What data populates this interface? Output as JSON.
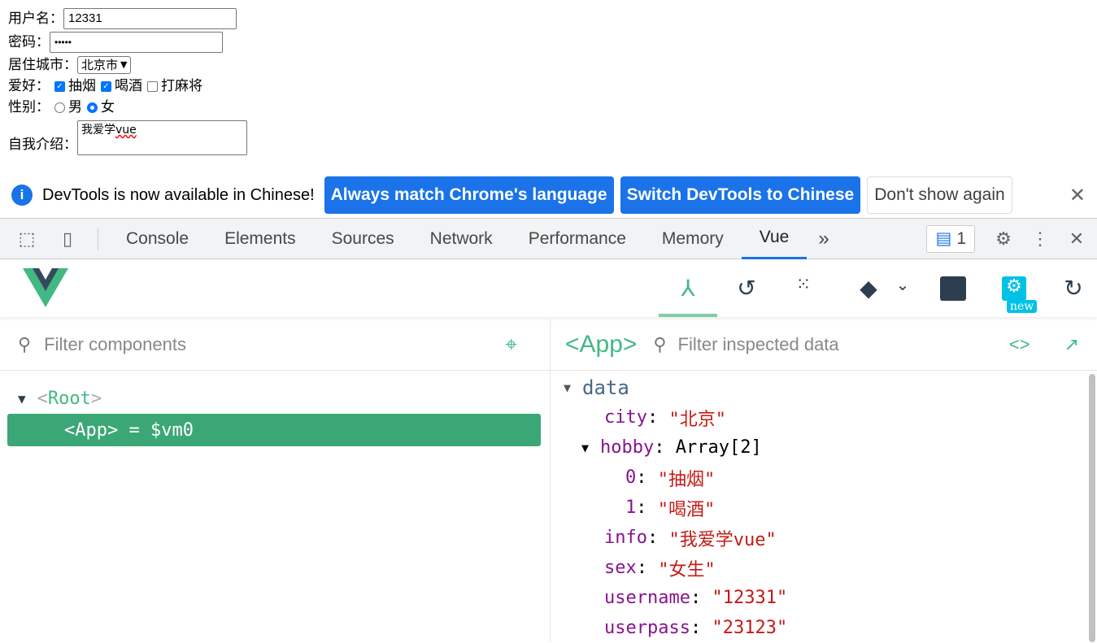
{
  "form": {
    "username_label": "用户名：",
    "username": "12331",
    "password_label": "密码：",
    "password_mask": "•••••",
    "city_label": "居住城市：",
    "city_selected": "北京市",
    "hobby_label": "爱好：",
    "hobbies": [
      {
        "label": "抽烟",
        "checked": true
      },
      {
        "label": "喝酒",
        "checked": true
      },
      {
        "label": "打麻将",
        "checked": false
      }
    ],
    "sex_label": "性别：",
    "sexes": [
      {
        "label": "男",
        "checked": false
      },
      {
        "label": "女",
        "checked": true
      }
    ],
    "intro_label": "自我介绍：",
    "intro_cn": "我爱学",
    "intro_en": "vue"
  },
  "infobar": {
    "icon": "info-icon",
    "message": "DevTools is now available in Chinese!",
    "btn1": "Always match Chrome's language",
    "btn2": "Switch DevTools to Chinese",
    "btn3": "Don't show again",
    "close": "✕"
  },
  "devtools": {
    "tabs": [
      "Console",
      "Elements",
      "Sources",
      "Network",
      "Performance",
      "Memory",
      "Vue"
    ],
    "active_tab": "Vue",
    "more": "»",
    "issues_count": "1",
    "accent": "#1a73e8"
  },
  "vue": {
    "new_badge": "new",
    "accent": "#42b983",
    "filter_components": "Filter components",
    "filter_inspected": "Filter inspected data",
    "selected": "<App>",
    "tree": {
      "root": "Root",
      "app": "App",
      "vm": "= $vm0"
    },
    "data": {
      "section": "data",
      "rows": [
        {
          "key": "city",
          "value": "\"北京\""
        },
        {
          "key": "hobby",
          "value": "Array[2]",
          "expanded": true
        },
        {
          "key": "0",
          "value": "\"抽烟\""
        },
        {
          "key": "1",
          "value": "\"喝酒\""
        },
        {
          "key": "info",
          "value": "\"我爱学vue\""
        },
        {
          "key": "sex",
          "value": "\"女生\""
        },
        {
          "key": "username",
          "value": "\"12331\""
        },
        {
          "key": "userpass",
          "value": "\"23123\""
        }
      ]
    }
  }
}
